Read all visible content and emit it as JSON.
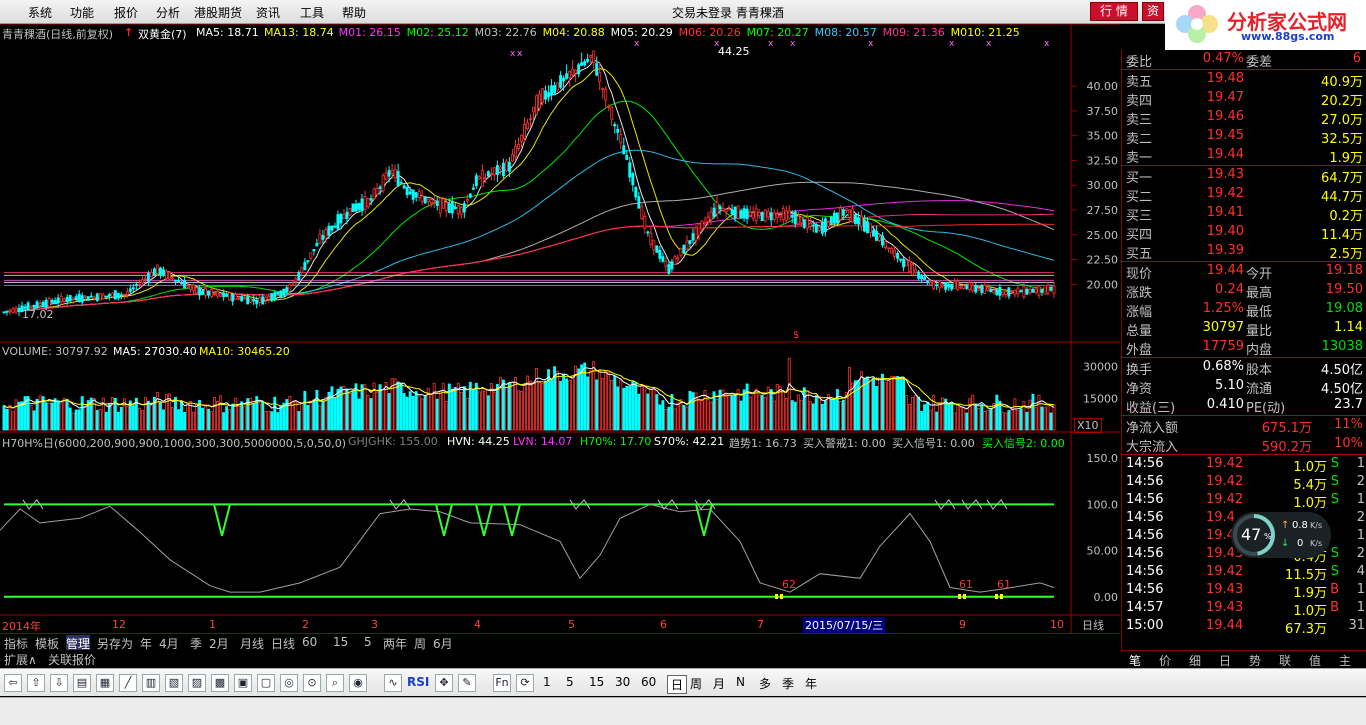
{
  "menu": [
    "系统",
    "功能",
    "报价",
    "分析",
    "港股期货",
    "资讯",
    "工具",
    "帮助"
  ],
  "window_title": "交易未登录   青青稞酒",
  "trade_button": "行 情",
  "trade_button2": "资",
  "logo": {
    "name": "分析家公式网",
    "url": "www.88gs.com"
  },
  "kline": {
    "title": "青青稞酒(日线,前复权)",
    "indicator": "双黄金(7)",
    "ma": [
      {
        "label": "MA5: 18.71",
        "color": "#ffffff"
      },
      {
        "label": "MA13: 18.74",
        "color": "#ffff00"
      },
      {
        "label": "M01: 26.15",
        "color": "#ff33ff"
      },
      {
        "label": "M02: 25.12",
        "color": "#00ff00"
      },
      {
        "label": "M03: 22.76",
        "color": "#c0c0c0"
      },
      {
        "label": "M04: 20.88",
        "color": "#ffff00"
      },
      {
        "label": "M05: 20.29",
        "color": "#ffffff"
      },
      {
        "label": "M06: 20.26",
        "color": "#ff3333"
      },
      {
        "label": "M07: 20.27",
        "color": "#00ff00"
      },
      {
        "label": "M08: 20.57",
        "color": "#33ccff"
      },
      {
        "label": "M09: 21.36",
        "color": "#ff3388"
      },
      {
        "label": "M010: 21.25",
        "color": "#ffff00"
      }
    ],
    "high_label": "44.25",
    "low_label": "17.02",
    "y_ticks": [
      "40.00",
      "37.50",
      "35.00",
      "32.50",
      "30.00",
      "27.50",
      "25.00",
      "22.50",
      "20.00"
    ]
  },
  "volume": {
    "label": "VOLUME: 30797.92",
    "ma5": "MA5: 27030.40",
    "ma10": "MA10: 30465.20",
    "y_ticks": [
      "30000",
      "15000"
    ],
    "unit": "X10"
  },
  "h70": {
    "label": "H70H%日(6000,200,900,900,1000,300,300,5000000,5,0,50,0)",
    "ghj": "GHJGHK: 155.00",
    "hvn": "HVN: 44.25",
    "lvn": "LVN: 14.07",
    "h70": "H70%: 17.70",
    "s70": "S70%: 42.21",
    "trend": "趋势1: 16.73",
    "warn": "买入警戒1: 0.00",
    "sig1": "买入信号1: 0.00",
    "sig2": "买入信号2: 0.00",
    "y_ticks": [
      "150.0",
      "100.0",
      "50.00",
      "0.00"
    ],
    "markers": [
      "62",
      "61",
      "61"
    ]
  },
  "time_axis": {
    "labels": [
      "2014年",
      "12",
      "1",
      "2",
      "3",
      "4",
      "5",
      "6",
      "7",
      "9",
      "10"
    ],
    "cursor": "2015/07/15/三",
    "period": "日线"
  },
  "quote": {
    "committee": [
      {
        "label": "委比",
        "value": "0.47%",
        "label2": "委差",
        "value2": "6"
      }
    ],
    "sell": [
      {
        "label": "卖五",
        "price": "19.48",
        "vol": "40.9万"
      },
      {
        "label": "卖四",
        "price": "19.47",
        "vol": "20.2万"
      },
      {
        "label": "卖三",
        "price": "19.46",
        "vol": "27.0万"
      },
      {
        "label": "卖二",
        "price": "19.45",
        "vol": "32.5万"
      },
      {
        "label": "卖一",
        "price": "19.44",
        "vol": "1.9万"
      }
    ],
    "buy": [
      {
        "label": "买一",
        "price": "19.43",
        "vol": "64.7万"
      },
      {
        "label": "买二",
        "price": "19.42",
        "vol": "44.7万"
      },
      {
        "label": "买三",
        "price": "19.41",
        "vol": "0.2万"
      },
      {
        "label": "买四",
        "price": "19.40",
        "vol": "11.4万"
      },
      {
        "label": "买五",
        "price": "19.39",
        "vol": "2.5万"
      }
    ],
    "stats": [
      {
        "l1": "现价",
        "v1": "19.44",
        "l2": "今开",
        "v2": "19.18"
      },
      {
        "l1": "涨跌",
        "v1": "0.24",
        "l2": "最高",
        "v2": "19.50"
      },
      {
        "l1": "涨幅",
        "v1": "1.25%",
        "l2": "最低",
        "v2": "19.08"
      },
      {
        "l1": "总量",
        "v1": "30797",
        "l2": "量比",
        "v2": "1.14"
      },
      {
        "l1": "外盘",
        "v1": "17759",
        "l2": "内盘",
        "v2": "13038"
      }
    ],
    "stats2": [
      {
        "l1": "换手",
        "v1": "0.68%",
        "l2": "股本",
        "v2": "4.50亿"
      },
      {
        "l1": "净资",
        "v1": "5.10",
        "l2": "流通",
        "v2": "4.50亿"
      },
      {
        "l1": "收益(三)",
        "v1": "0.410",
        "l2": "PE(动)",
        "v2": "23.7"
      }
    ],
    "flow": [
      {
        "label": "净流入额",
        "value": "675.1万",
        "pct": "11%"
      },
      {
        "label": "大宗流入",
        "value": "590.2万",
        "pct": "10%"
      }
    ],
    "ticks": [
      {
        "t": "14:56",
        "p": "19.42",
        "v": "1.0万",
        "d": "S",
        "n": "1"
      },
      {
        "t": "14:56",
        "p": "19.42",
        "v": "5.4万",
        "d": "S",
        "n": "2"
      },
      {
        "t": "14:56",
        "p": "19.42",
        "v": "1.0万",
        "d": "S",
        "n": "1"
      },
      {
        "t": "14:56",
        "p": "19.4",
        "v": "",
        "d": "",
        "n": "2"
      },
      {
        "t": "14:56",
        "p": "19.4",
        "v": "",
        "d": "",
        "n": "1"
      },
      {
        "t": "14:56",
        "p": "19.43",
        "v": "0.4万",
        "d": "S",
        "n": "2"
      },
      {
        "t": "14:56",
        "p": "19.42",
        "v": "11.5万",
        "d": "S",
        "n": "4"
      },
      {
        "t": "14:56",
        "p": "19.43",
        "v": "1.9万",
        "d": "B",
        "n": "1"
      },
      {
        "t": "14:57",
        "p": "19.43",
        "v": "1.0万",
        "d": "B",
        "n": "1"
      },
      {
        "t": "15:00",
        "p": "19.44",
        "v": "67.3万",
        "d": "",
        "n": "31"
      }
    ],
    "gauge": {
      "pct": "47",
      "unit": "%",
      "up": "0.8",
      "down": "0",
      "rate": "K/s"
    }
  },
  "bottom_tabs": [
    "指标",
    "模板",
    "管理",
    "另存为",
    "年",
    "4月",
    "季",
    "2月",
    "月线",
    "日线",
    "60",
    "15",
    "5",
    "两年",
    "周",
    "6月"
  ],
  "ext_tabs": [
    "扩展∧",
    "关联报价"
  ],
  "right_tabs": [
    "笔",
    "价",
    "细",
    "日",
    "势",
    "联",
    "值",
    "主"
  ],
  "toolbar_text": [
    "RSI",
    "1",
    "5",
    "15",
    "30",
    "60",
    "日",
    "周",
    "月",
    "N",
    "多",
    "季",
    "年"
  ]
}
